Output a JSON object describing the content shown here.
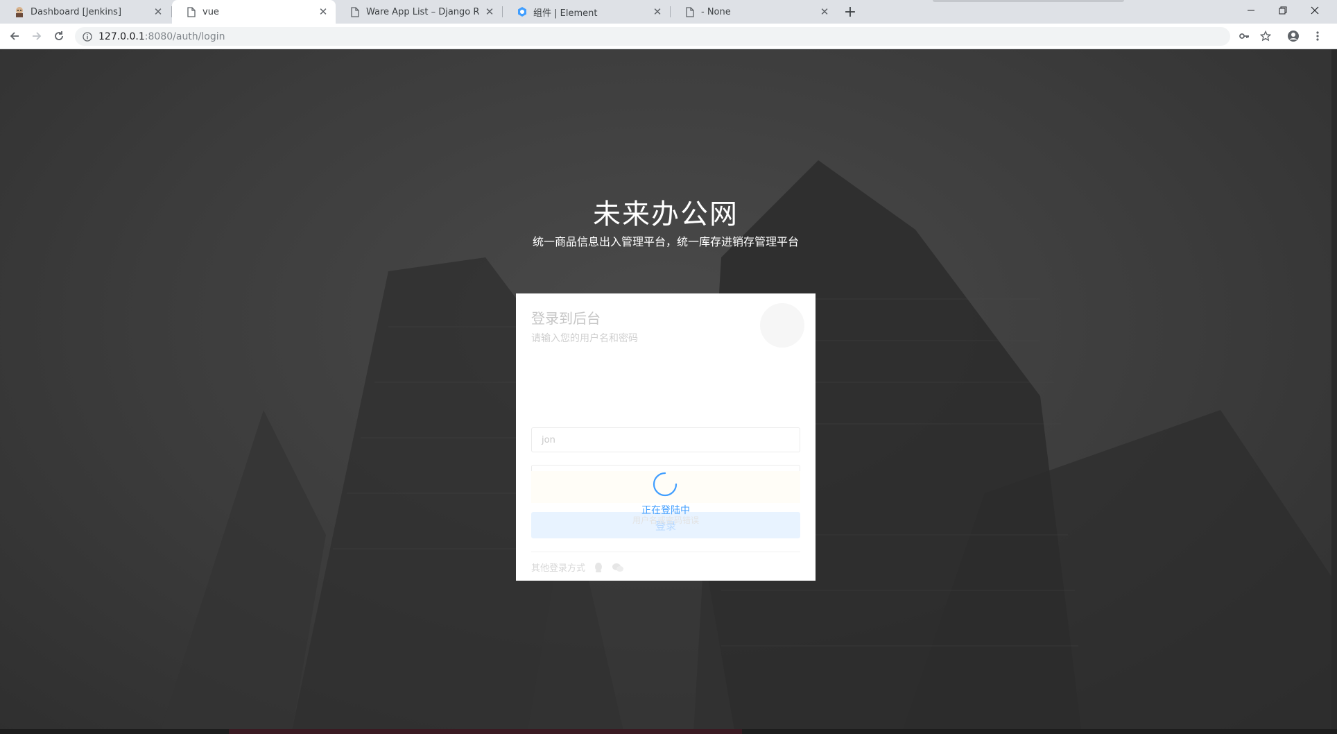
{
  "browser": {
    "tabs": [
      {
        "title": "Dashboard [Jenkins]",
        "icon": "jenkins-icon",
        "active": false
      },
      {
        "title": "vue",
        "icon": "page-icon",
        "active": true
      },
      {
        "title": "Ware App List – Django REST f",
        "icon": "page-icon",
        "active": false
      },
      {
        "title": "组件 | Element",
        "icon": "element-icon",
        "active": false
      },
      {
        "title": "- None",
        "icon": "page-icon",
        "active": false
      }
    ],
    "url_host": "127.0.0.1",
    "url_path": ":8080/auth/login"
  },
  "page": {
    "brand_title": "未来办公网",
    "brand_subtitle": "统一商品信息出入管理平台，统一库存进销存管理平台",
    "login_card": {
      "heading": "登录到后台",
      "description": "请输入您的用户名和密码",
      "username_value": "jon",
      "password_value": "········",
      "login_button_label": "登录",
      "other_login_label": "其他登录方式"
    },
    "loading": {
      "text": "正在登陆中",
      "ghost_text": "用户名或密码错误"
    }
  },
  "colors": {
    "accent": "#409eff",
    "backdrop": "#3a3a3a"
  }
}
